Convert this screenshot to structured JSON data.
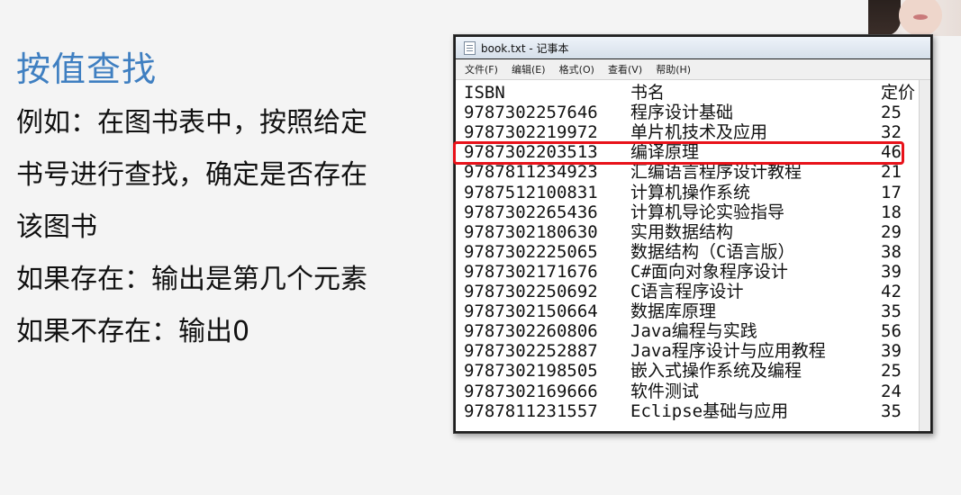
{
  "slide": {
    "title": "按值查找",
    "lines": [
      "例如：在图书表中，按照给定",
      "书号进行查找，确定是否存在",
      "该图书",
      "如果存在：输出是第几个元素",
      "如果不存在：输出0"
    ]
  },
  "notepad": {
    "window_title": "book.txt - 记事本",
    "menu": [
      "文件(F)",
      "编辑(E)",
      "格式(O)",
      "查看(V)",
      "帮助(H)"
    ],
    "header": {
      "isbn": "ISBN",
      "name": "书名",
      "price": "定价"
    },
    "rows": [
      {
        "isbn": "9787302257646",
        "name": "程序设计基础",
        "price": "25"
      },
      {
        "isbn": "9787302219972",
        "name": "单片机技术及应用",
        "price": "32"
      },
      {
        "isbn": "9787302203513",
        "name": "编译原理",
        "price": "46"
      },
      {
        "isbn": "9787811234923",
        "name": "汇编语言程序设计教程",
        "price": "21"
      },
      {
        "isbn": "9787512100831",
        "name": "计算机操作系统",
        "price": "17"
      },
      {
        "isbn": "9787302265436",
        "name": "计算机导论实验指导",
        "price": "18"
      },
      {
        "isbn": "9787302180630",
        "name": "实用数据结构",
        "price": "29"
      },
      {
        "isbn": "9787302225065",
        "name": "数据结构（C语言版）",
        "price": "38"
      },
      {
        "isbn": "9787302171676",
        "name": "C#面向对象程序设计",
        "price": "39"
      },
      {
        "isbn": "9787302250692",
        "name": "C语言程序设计",
        "price": "42"
      },
      {
        "isbn": "9787302150664",
        "name": "数据库原理",
        "price": "35"
      },
      {
        "isbn": "9787302260806",
        "name": "Java编程与实践",
        "price": "56"
      },
      {
        "isbn": "9787302252887",
        "name": "Java程序设计与应用教程",
        "price": "39"
      },
      {
        "isbn": "9787302198505",
        "name": "嵌入式操作系统及编程",
        "price": "25"
      },
      {
        "isbn": "9787302169666",
        "name": "软件测试",
        "price": "24"
      },
      {
        "isbn": "9787811231557",
        "name": "Eclipse基础与应用",
        "price": "35"
      }
    ],
    "highlighted_row_index": 2
  },
  "colors": {
    "title": "#3f7fc1",
    "highlight": "#e8121a"
  }
}
